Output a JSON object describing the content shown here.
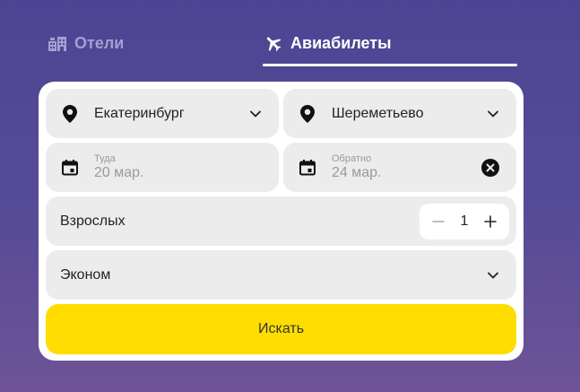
{
  "tabs": {
    "hotels": "Отели",
    "flights": "Авиабилеты"
  },
  "form": {
    "from": {
      "value": "Екатеринбург"
    },
    "to": {
      "value": "Шереметьево"
    },
    "departure": {
      "label": "Туда",
      "value": "20 мар."
    },
    "return": {
      "label": "Обратно",
      "value": "24 мар."
    },
    "adults": {
      "label": "Взрослых",
      "count": "1"
    },
    "cabin_class": {
      "value": "Эконом"
    },
    "search_label": "Искать"
  },
  "colors": {
    "accent": "#ffdd00",
    "background_top": "#4d4593",
    "field_bg": "#ececec",
    "inactive_tab": "#a59fd2"
  },
  "icons": {
    "hotels": "hotel-icon",
    "flights": "airplane-icon",
    "location": "location-pin-icon",
    "calendar": "calendar-icon",
    "dropdown": "chevron-down-icon",
    "clear": "clear-icon",
    "minus": "minus-icon",
    "plus": "plus-icon"
  }
}
